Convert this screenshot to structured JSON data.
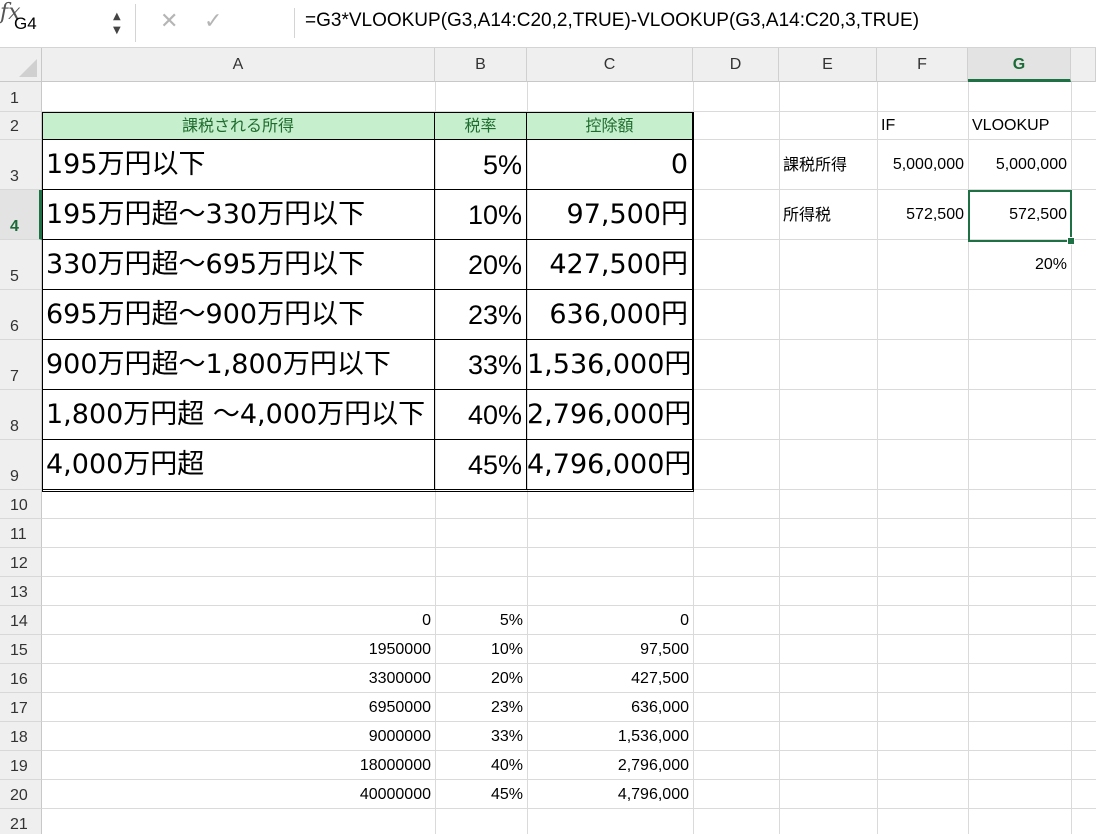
{
  "formula_bar": {
    "name_box": "G4",
    "cancel_icon": "✕",
    "enter_icon": "✓",
    "fx_label": "fx",
    "formula": "=G3*VLOOKUP(G3,A14:C20,2,TRUE)-VLOOKUP(G3,A14:C20,3,TRUE)"
  },
  "columns": [
    "A",
    "B",
    "C",
    "D",
    "E",
    "F",
    "G"
  ],
  "rows": [
    "1",
    "2",
    "3",
    "4",
    "5",
    "6",
    "7",
    "8",
    "9",
    "10",
    "11",
    "12",
    "13",
    "14",
    "15",
    "16",
    "17",
    "18",
    "19",
    "20",
    "21"
  ],
  "active_cell": "G4",
  "tax_table": {
    "headers": [
      "課税される所得",
      "税率",
      "控除額"
    ],
    "rows": [
      [
        "195万円以下",
        "5%",
        "0"
      ],
      [
        "195万円超〜330万円以下",
        "10%",
        "97,500円"
      ],
      [
        "330万円超〜695万円以下",
        "20%",
        "427,500円"
      ],
      [
        "695万円超〜900万円以下",
        "23%",
        "636,000円"
      ],
      [
        "900万円超〜1,800万円以下",
        "33%",
        "1,536,000円"
      ],
      [
        "1,800万円超 〜4,000万円以下",
        "40%",
        "2,796,000円"
      ],
      [
        "4,000万円超",
        "45%",
        "4,796,000円"
      ]
    ]
  },
  "side_calc": {
    "f2": "IF",
    "g2": "VLOOKUP",
    "e3": "課税所得",
    "f3": "5,000,000",
    "g3": "5,000,000",
    "e4": "所得税",
    "f4": "572,500",
    "g4": "572,500",
    "g5": "20%"
  },
  "lookup_table": [
    [
      "0",
      "5%",
      "0"
    ],
    [
      "1950000",
      "10%",
      "97,500"
    ],
    [
      "3300000",
      "20%",
      "427,500"
    ],
    [
      "6950000",
      "23%",
      "636,000"
    ],
    [
      "9000000",
      "33%",
      "1,536,000"
    ],
    [
      "18000000",
      "40%",
      "2,796,000"
    ],
    [
      "40000000",
      "45%",
      "4,796,000"
    ]
  ]
}
